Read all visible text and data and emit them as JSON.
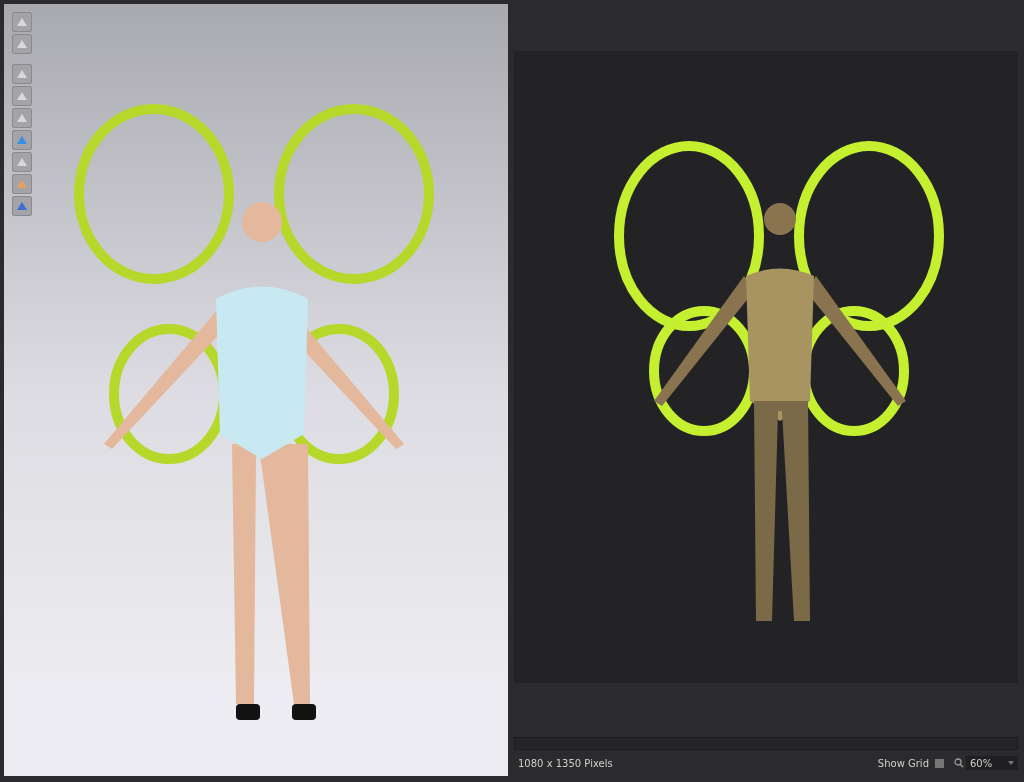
{
  "status_bar": {
    "size": "1080 x 1350 Pixels",
    "show_grid": {
      "label": "Show Grid",
      "checked": false
    },
    "zoom": {
      "value": "60%"
    }
  }
}
